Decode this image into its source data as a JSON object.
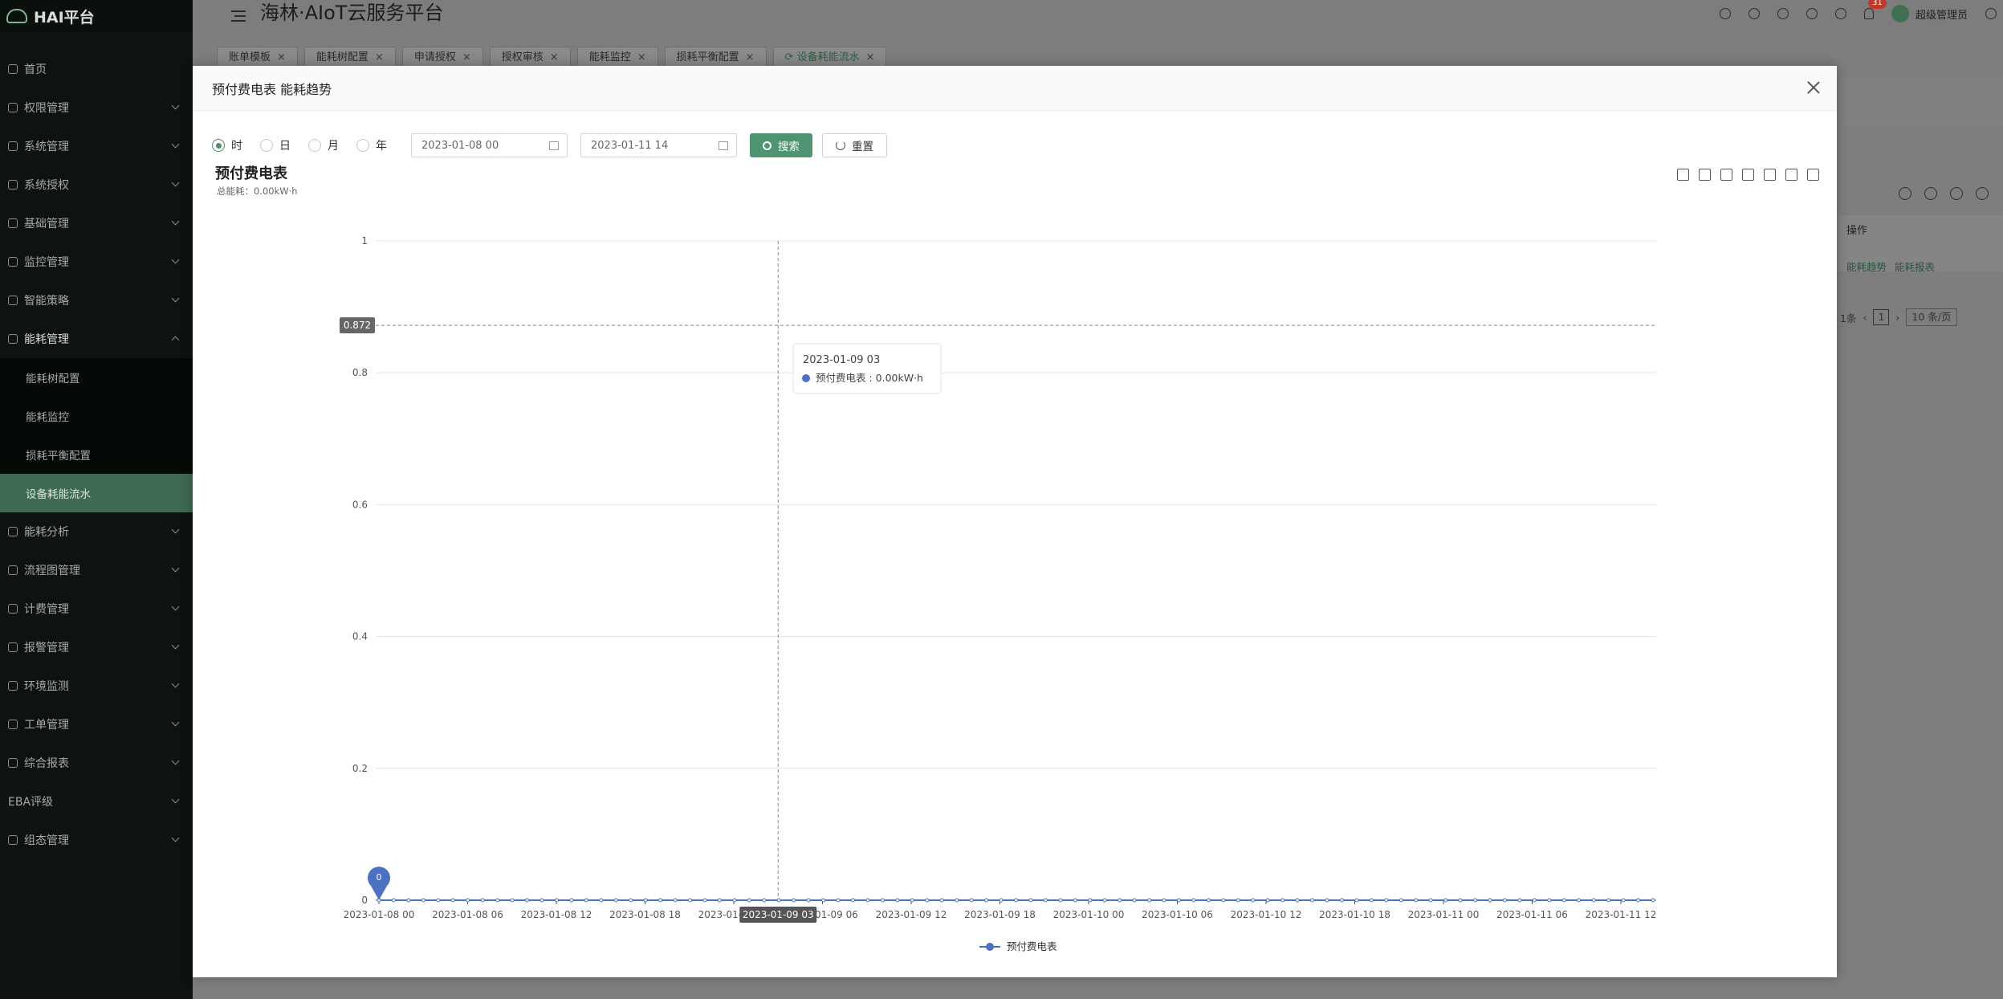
{
  "app": {
    "logo_text": "HAI平台",
    "platform_title": "海林·AIoT云服务平台",
    "user_name": "超级管理员",
    "notification_count": "31"
  },
  "sidebar": {
    "items": [
      {
        "label": "首页"
      },
      {
        "label": "权限管理"
      },
      {
        "label": "系统管理"
      },
      {
        "label": "系统授权"
      },
      {
        "label": "基础管理"
      },
      {
        "label": "监控管理"
      },
      {
        "label": "智能策略"
      },
      {
        "label": "能耗管理"
      },
      {
        "label": "能耗分析"
      },
      {
        "label": "流程图管理"
      },
      {
        "label": "计费管理"
      },
      {
        "label": "报警管理"
      },
      {
        "label": "环境监测"
      },
      {
        "label": "工单管理"
      },
      {
        "label": "综合报表"
      },
      {
        "label": "EBA评级"
      },
      {
        "label": "组态管理"
      }
    ],
    "energy_submenu": [
      {
        "label": "能耗树配置"
      },
      {
        "label": "能耗监控"
      },
      {
        "label": "损耗平衡配置"
      },
      {
        "label": "设备耗能流水"
      }
    ]
  },
  "tabs": [
    {
      "label": "账单模板"
    },
    {
      "label": "能耗树配置"
    },
    {
      "label": "申请授权"
    },
    {
      "label": "授权审核"
    },
    {
      "label": "能耗监控"
    },
    {
      "label": "损耗平衡配置"
    },
    {
      "label": "设备耗能流水"
    }
  ],
  "background_page": {
    "op_header": "操作",
    "trend_link": "能耗趋势",
    "report_link": "能耗报表",
    "pager_total": "1条",
    "pager_current": "1",
    "pager_size": "10 条/页"
  },
  "modal": {
    "title": "预付费电表 能耗趋势",
    "radios": [
      "时",
      "日",
      "月",
      "年"
    ],
    "start_date": "2023-01-08 00",
    "end_date": "2023-01-11 14",
    "search_label": "搜索",
    "reset_label": "重置"
  },
  "chart_data": {
    "type": "line",
    "title": "预付费电表",
    "subtitle": "总能耗：0.00kW·h",
    "ylim": [
      0,
      1
    ],
    "y_ticks": [
      "0",
      "0.2",
      "0.4",
      "0.6",
      "0.8",
      "1"
    ],
    "x_tick_labels": [
      "2023-01-08 00",
      "2023-01-08 06",
      "2023-01-08 12",
      "2023-01-08 18",
      "2023-01-09 00",
      "2023-01-09 06",
      "2023-01-09 12",
      "2023-01-09 18",
      "2023-01-10 00",
      "2023-01-10 06",
      "2023-01-10 12",
      "2023-01-10 18",
      "2023-01-11 00",
      "2023-01-11 06",
      "2023-01-11 12"
    ],
    "series": [
      {
        "name": "预付费电表",
        "color": "#4a72c0",
        "point_count": 87,
        "value": 0
      }
    ],
    "crosshair": {
      "y_value": "0.872",
      "x_label": "2023-01-09 03"
    },
    "tooltip": {
      "date": "2023-01-09 03",
      "text": "预付费电表 : 0.00kW·h"
    },
    "marker_label": "0",
    "legend": "预付费电表",
    "grid": true
  }
}
